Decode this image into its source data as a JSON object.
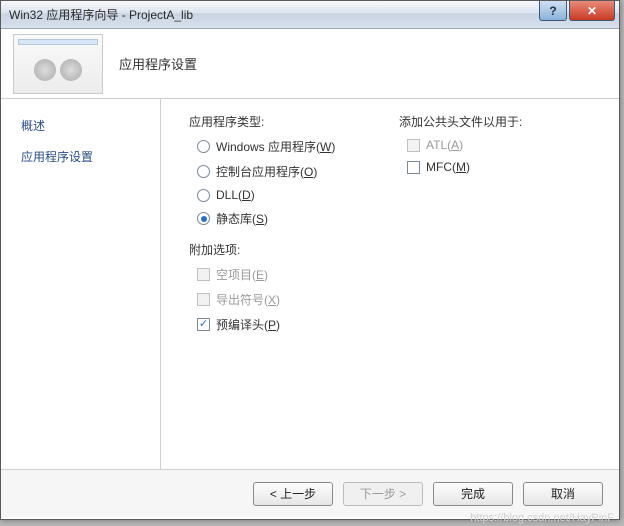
{
  "window": {
    "title": "Win32 应用程序向导 - ProjectA_lib",
    "help": "?",
    "close": "✕"
  },
  "header": {
    "title": "应用程序设置"
  },
  "sidebar": {
    "items": [
      {
        "label": "概述"
      },
      {
        "label": "应用程序设置"
      }
    ]
  },
  "main": {
    "app_type_label": "应用程序类型:",
    "app_types": {
      "windows": {
        "text": "Windows 应用程序(",
        "key": "W",
        "suffix": ")",
        "selected": false
      },
      "console": {
        "text": "控制台应用程序(",
        "key": "O",
        "suffix": ")",
        "selected": false
      },
      "dll": {
        "text": "DLL(",
        "key": "D",
        "suffix": ")",
        "selected": false
      },
      "static": {
        "text": "静态库(",
        "key": "S",
        "suffix": ")",
        "selected": true
      }
    },
    "extra_label": "附加选项:",
    "extras": {
      "empty": {
        "text": "空项目(",
        "key": "E",
        "suffix": ")",
        "enabled": false,
        "checked": false
      },
      "export": {
        "text": "导出符号(",
        "key": "X",
        "suffix": ")",
        "enabled": false,
        "checked": false
      },
      "precomp": {
        "text": "预编译头(",
        "key": "P",
        "suffix": ")",
        "enabled": true,
        "checked": true
      }
    },
    "headers_label": "添加公共头文件以用于:",
    "headers": {
      "atl": {
        "text": "ATL(",
        "key": "A",
        "suffix": ")",
        "enabled": false,
        "checked": false
      },
      "mfc": {
        "text": "MFC(",
        "key": "M",
        "suffix": ")",
        "enabled": true,
        "checked": false
      }
    }
  },
  "footer": {
    "back": "< 上一步",
    "next": "下一步 >",
    "finish": "完成",
    "cancel": "取消"
  },
  "watermark": "https://blog.csdn.net/HayPinF"
}
